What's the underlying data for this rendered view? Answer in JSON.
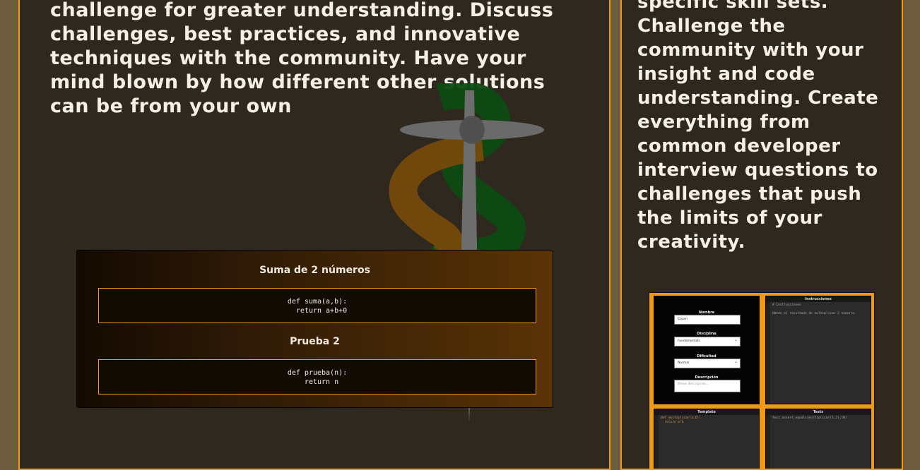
{
  "left": {
    "paragraph": "challenge for greater understanding. Discuss challenges, best practices, and innovative techniques with the community. Have your mind blown by how different other solutions can be from your own"
  },
  "right": {
    "paragraph": "specific skill sets. Challenge the community with your insight and code understanding. Create everything from common developer interview questions to challenges that push the limits of your creativity."
  },
  "code_card": {
    "items": [
      {
        "title": "Suma de 2 números",
        "code": "def suma(a,b):\n  return a+b+0"
      },
      {
        "title": "Prueba 2",
        "code": "def prueba(n):\n  return n"
      }
    ]
  },
  "mini": {
    "form": {
      "nombre_label": "Nombre",
      "nombre_value": "Espari",
      "disciplina_label": "Disciplina",
      "disciplina_value": "Fundamentals",
      "dificultad_label": "Dificultad",
      "dificultad_value": "Normal",
      "descripcion_label": "Descripción",
      "descripcion_placeholder": "Breve descripción..."
    },
    "instructions": {
      "title": "Instrucciones",
      "code": "# Instrucciones\n\nObtén el resultado de multiplicar 2 números."
    },
    "template": {
      "title": "Template",
      "code": "def multiplicar(a,b):\n  return a*b"
    },
    "tests": {
      "title": "Tests",
      "code": "test.assert_equals(multiplicar(1,2),10)"
    }
  },
  "colors": {
    "accent": "#f29a14",
    "panel_bg": "#2f281f",
    "page_bg": "#6e5c3e"
  }
}
